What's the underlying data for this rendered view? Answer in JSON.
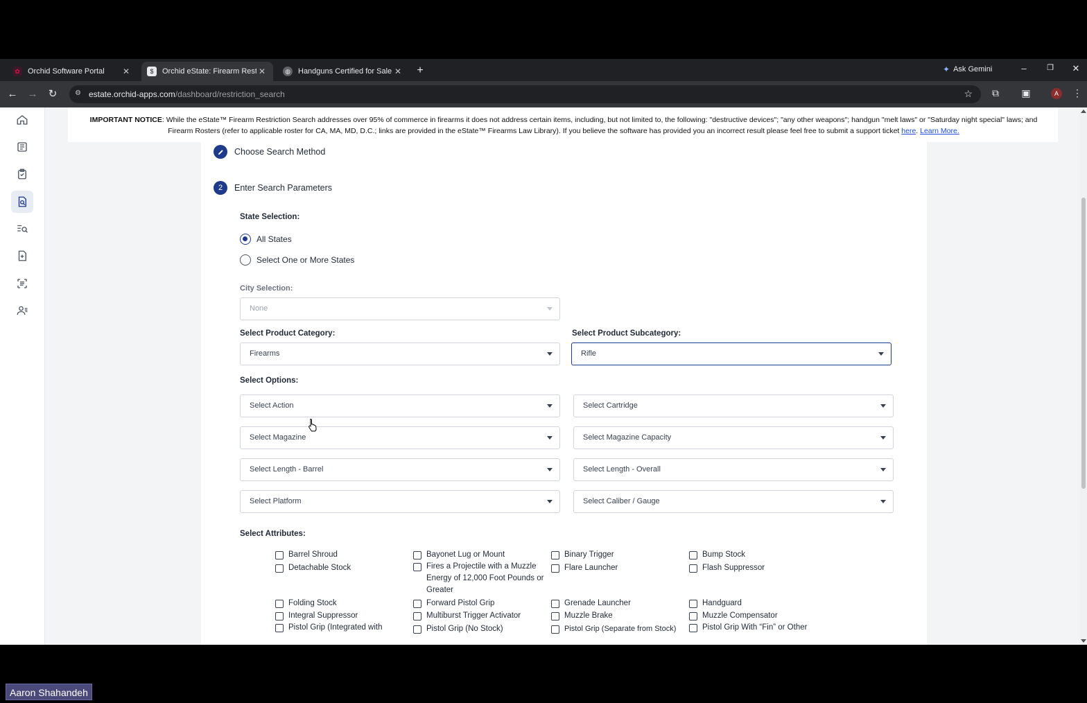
{
  "browser": {
    "tabs": [
      {
        "title": "Orchid Software Portal",
        "active": false
      },
      {
        "title": "Orchid eState: Firearm Restrictio",
        "active": true
      },
      {
        "title": "Handguns Certified for Sale | St",
        "active": false
      }
    ],
    "new_tab": "+",
    "gemini_label": "Ask Gemini",
    "url_host": "estate.orchid-apps.com",
    "url_path": "/dashboard/restriction_search",
    "profile_initial": "A"
  },
  "notice": {
    "prefix": "IMPORTANT NOTICE",
    "body": ": While the eState™ Firearm Restriction Search addresses over 95% of commerce in firearms it does not address certain items, including, but not limited to, the following: \"destructive devices\"; \"any other weapons\"; handgun \"melt laws\" or \"Saturday night special\" laws; and Firearm Rosters (refer to applicable roster for CA, MA, MD, D.C.; links are provided in the eState™ Firearms Law Library). If you believe the software has provided you an incorrect result please feel free to submit a support ticket ",
    "link_here": "here",
    "link_learn": "Learn More."
  },
  "steps": {
    "step1": {
      "label": "Choose Search Method"
    },
    "step2": {
      "number": "2",
      "label": "Enter Search Parameters"
    }
  },
  "form": {
    "state_selection_label": "State Selection:",
    "state_options": [
      "All States",
      "Select One or More States"
    ],
    "state_selected": "All States",
    "city_label": "City Selection:",
    "city_value": "None",
    "category_label": "Select Product Category:",
    "category_value": "Firearms",
    "subcategory_label": "Select Product Subcategory:",
    "subcategory_value": "Rifle",
    "options_label": "Select Options:",
    "options": [
      "Select Action",
      "Select Cartridge",
      "Select Magazine",
      "Select Magazine Capacity",
      "Select Length - Barrel",
      "Select Length - Overall",
      "Select Platform",
      "Select Caliber / Gauge"
    ],
    "attributes_label": "Select Attributes:",
    "attributes": [
      "Barrel Shroud",
      "Bayonet Lug or Mount",
      "Binary Trigger",
      "Bump Stock",
      "Detachable Stock",
      "Fires a Projectile with a Muzzle Energy of 12,000 Foot Pounds or Greater",
      "Flare Launcher",
      "Flash Suppressor",
      "Folding Stock",
      "Forward Pistol Grip",
      "Grenade Launcher",
      "Handguard",
      "Integral Suppressor",
      "Multiburst Trigger Activator",
      "Muzzle Brake",
      "Muzzle Compensator",
      "Pistol Grip (Integrated with",
      "Pistol Grip (No Stock)",
      "Pistol Grip (Separate from Stock)",
      "Pistol Grip With “Fin” or Other"
    ]
  },
  "overlay": {
    "user_name": "Aaron Shahandeh"
  },
  "colors": {
    "accent": "#1e3a8a",
    "link": "#1d4ed8",
    "page_bg": "#f3f4f6"
  }
}
